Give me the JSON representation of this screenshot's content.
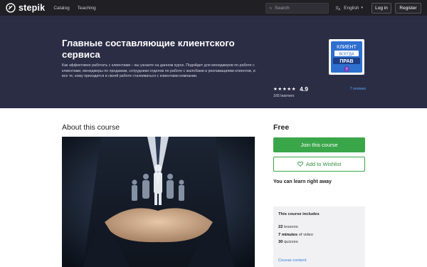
{
  "nav": {
    "brand": "stepik",
    "links": [
      "Catalog",
      "Teaching"
    ],
    "search_placeholder": "Search",
    "language": "English",
    "login": "Log in",
    "register": "Register"
  },
  "hero": {
    "title": "Главные составляющие клиентского сервиса",
    "description": "Как эффективно работать с клиентами – вы узнаете на данном курсе. Подойдет для менеджеров по работе с клиентами, менеджеры по продажам, сотрудники отделов по работе с жалобами и рекламациями клиентов, и все те, кому приходится в своей работе сталкиваться с клиентами компании.",
    "badge_lines": [
      "КЛИЕНТ",
      "ВСЕГДА",
      "ПРАВ"
    ],
    "badge_mark": "?",
    "stars": "★★★★★",
    "rating": "4.9",
    "reviews": "7 reviews",
    "learners": "165 learners"
  },
  "about": {
    "heading": "About this course"
  },
  "sidebar": {
    "price": "Free",
    "join_button": "Join this course",
    "wishlist_button": "Add to Wishlist",
    "learn_now": "You can learn right away",
    "includes": {
      "title": "This course includes",
      "items": [
        {
          "count": "22",
          "label": "lessons"
        },
        {
          "count": "7 minutes",
          "label": "of video"
        },
        {
          "count": "30",
          "label": "quizzes"
        }
      ],
      "content_link": "Course content"
    }
  },
  "colors": {
    "nav_bg": "#1f1f24",
    "hero_bg": "#2b2d45",
    "accent_green": "#3aa64a",
    "link_blue": "#2e7bd6"
  }
}
